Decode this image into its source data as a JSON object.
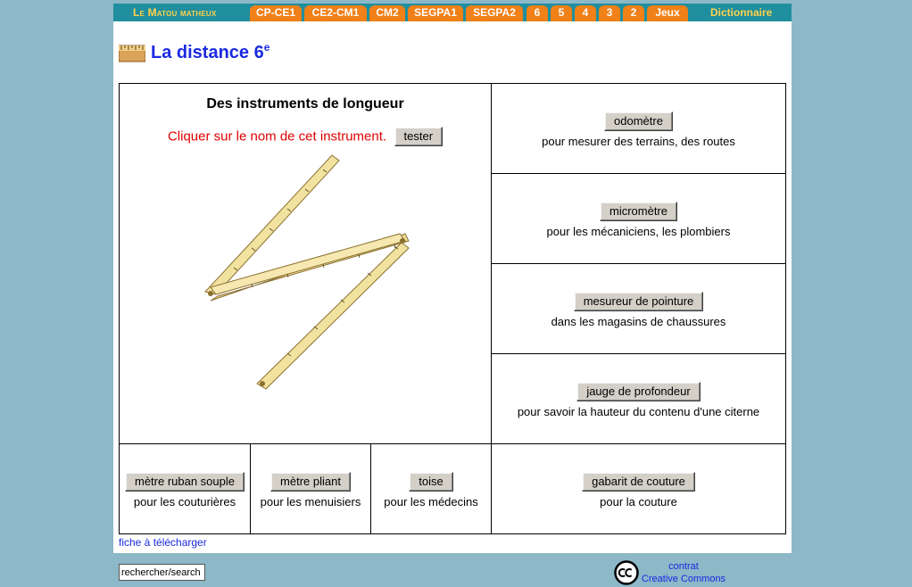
{
  "nav": {
    "brand": "Le Matou matheux",
    "tabs": [
      "CP-CE1",
      "CE2-CM1",
      "CM2",
      "SEGPA1",
      "SEGPA2",
      "6",
      "5",
      "4",
      "3",
      "2",
      "Jeux"
    ],
    "dictionary": "Dictionnaire"
  },
  "header": {
    "title": "La distance 6",
    "title_sup": "e"
  },
  "exercise": {
    "heading": "Des instruments de longueur",
    "prompt": "Cliquer sur le nom de cet instrument.",
    "test_button": "tester"
  },
  "instruments": [
    {
      "name": "odomètre",
      "desc": "pour mesurer des terrains, des routes"
    },
    {
      "name": "micromètre",
      "desc": "pour les mécaniciens, les plombiers"
    },
    {
      "name": "mesureur de pointure",
      "desc": "dans les magasins de chaussures"
    },
    {
      "name": "jauge de profondeur",
      "desc": "pour savoir la hauteur du contenu d'une citerne"
    },
    {
      "name": "mètre ruban souple",
      "desc": "pour les couturières"
    },
    {
      "name": "mètre pliant",
      "desc": "pour les menuisiers"
    },
    {
      "name": "toise",
      "desc": "pour les médecins"
    },
    {
      "name": "gabarit de couture",
      "desc": "pour la couture"
    }
  ],
  "footer": {
    "download": "fiche à télécharger",
    "search_value": "rechercher/search",
    "cc_line1": "contrat",
    "cc_line2": "Creative Commons"
  },
  "colors": {
    "nav_bg": "#1f8f9f",
    "tab_bg": "#f08018",
    "brand": "#ffd24a",
    "title": "#1a2ae0",
    "prompt": "#e00000",
    "page_bg": "#8cb8c8"
  },
  "icons": [
    "ruler-logo-icon",
    "folding-ruler-image",
    "creative-commons-icon"
  ]
}
